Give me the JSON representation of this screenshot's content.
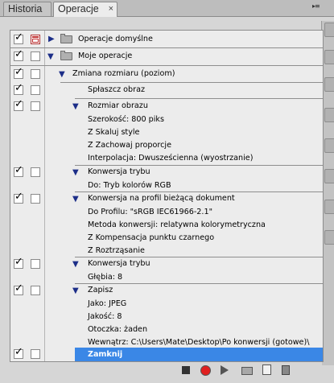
{
  "tabs": {
    "history": "Historia",
    "actions": "Operacje",
    "close_glyph": "×"
  },
  "panel_menu_glyph": "▸≡",
  "rows": [
    {
      "label": "Operacje domyślne"
    },
    {
      "label": "Moje operacje"
    },
    {
      "label": "Zmiana rozmiaru (poziom)"
    },
    {
      "label": "Spłaszcz obraz"
    },
    {
      "label": "Rozmiar obrazu"
    },
    {
      "label": "Szerokość: 800 piks"
    },
    {
      "label": "Z Skaluj style"
    },
    {
      "label": "Z Zachowaj proporcje"
    },
    {
      "label": "Interpolacja: Dwusześcienna (wyostrzanie)"
    },
    {
      "label": "Konwersja trybu"
    },
    {
      "label": "Do: Tryb kolorów RGB"
    },
    {
      "label": "Konwersja na profil bieżącą dokument"
    },
    {
      "label": "Do Profilu:  \"sRGB IEC61966-2.1\""
    },
    {
      "label": "Metoda konwersji: relatywna kolorymetryczna"
    },
    {
      "label": "Z Kompensacja punktu czarnego"
    },
    {
      "label": "Z Roztrząsanie"
    },
    {
      "label": "Konwersja trybu"
    },
    {
      "label": "Głębia: 8"
    },
    {
      "label": "Zapisz"
    },
    {
      "label": "Jako: JPEG"
    },
    {
      "label": "Jakość: 8"
    },
    {
      "label": "Otoczka: żaden"
    },
    {
      "label": "Wewnątrz: C:\\Users\\Mate\\Desktop\\Po konwersji (gotowe)\\"
    },
    {
      "label": "Zamknij"
    }
  ],
  "check_glyph": "✓",
  "expanded_glyph": "▼",
  "collapsed_glyph": "▶"
}
